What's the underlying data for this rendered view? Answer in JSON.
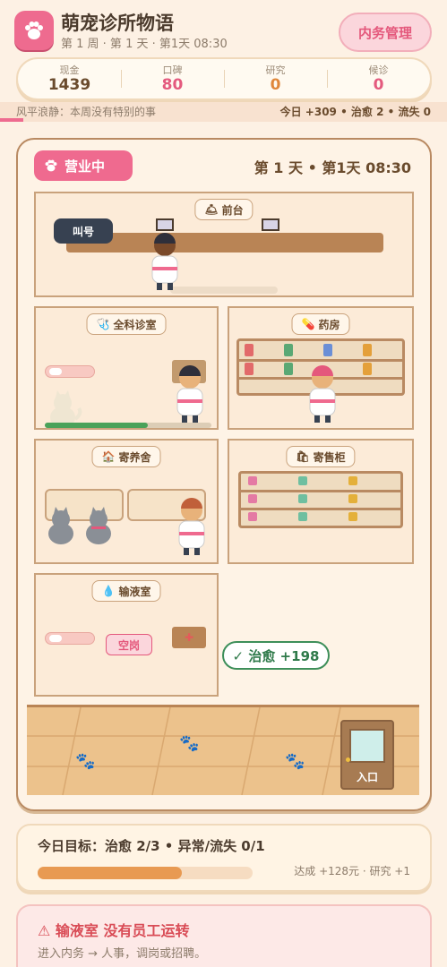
{
  "header": {
    "title": "萌宠诊所物语",
    "subtitle": "第 1 周 · 第 1 天 · 第1天 08:30",
    "mgmt_button": "内务管理",
    "icon": "paw-icon"
  },
  "stats": [
    {
      "label": "现金",
      "value": "1439"
    },
    {
      "label": "口碑",
      "value": "80"
    },
    {
      "label": "研究",
      "value": "0"
    },
    {
      "label": "候诊",
      "value": "0"
    }
  ],
  "ticker": {
    "message": "风平浪静：本周没有特别的事",
    "summary": "今日 +309 • 治愈 2 • 流失 0"
  },
  "panel": {
    "status": "营业中",
    "day": "第 1 天 • 第1天 08:30"
  },
  "rooms": {
    "front_desk": {
      "name": "前台",
      "icon": "bell-icon",
      "call_button": "叫号"
    },
    "general": {
      "name": "全科诊室",
      "icon": "stethoscope-icon",
      "progress": 0.62
    },
    "pharmacy": {
      "name": "药房",
      "icon": "pill-icon"
    },
    "boarding": {
      "name": "寄养舍",
      "icon": "house-icon"
    },
    "shop": {
      "name": "寄售柜",
      "icon": "shopping-bag-icon"
    },
    "infusion": {
      "name": "输液室",
      "icon": "droplet-icon",
      "status": "空岗"
    }
  },
  "heal_popup": "✓ 治愈 +198",
  "entrance": "入口",
  "goal": {
    "title": "今日目标：治愈 2/3 • 异常/流失 0/1",
    "progress": 0.67,
    "reward": "达成 +128元 · 研究 +1"
  },
  "alert": {
    "title": "⚠ 输液室 没有员工运转",
    "subtitle": "进入内务 → 人事，调岗或招聘。"
  },
  "colors": {
    "accent": "#ee6b8f",
    "wood": "#b98a62",
    "success": "#3e8f5a"
  }
}
